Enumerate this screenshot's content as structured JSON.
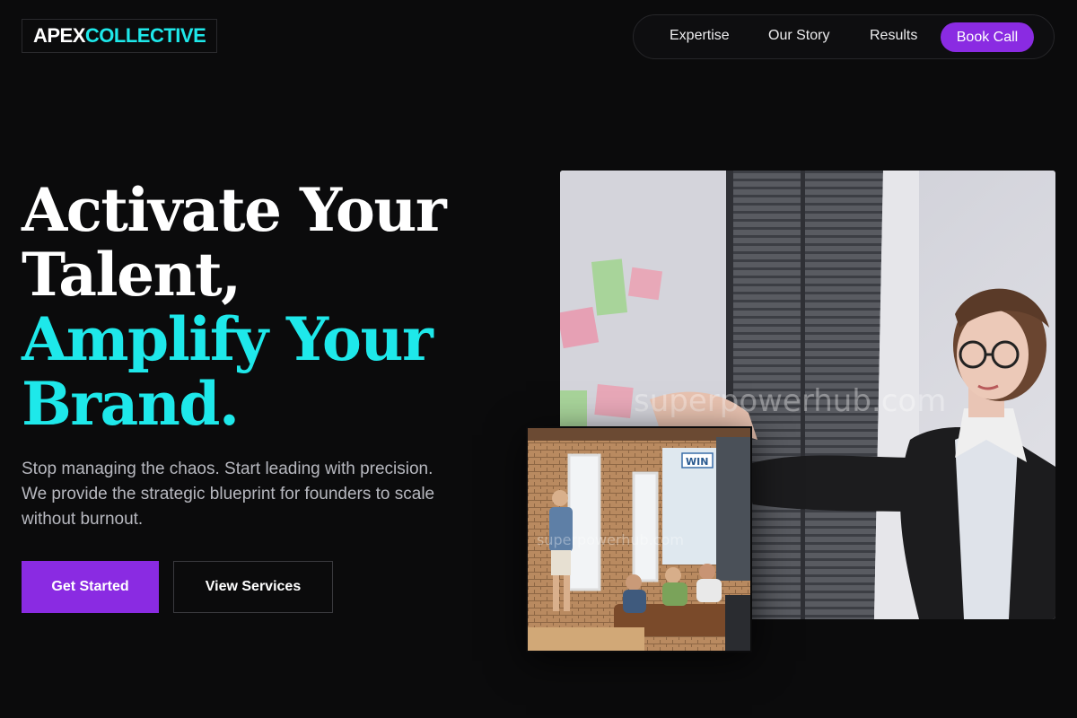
{
  "brand": {
    "part1": "APEX",
    "part2": "COLLECTIVE"
  },
  "nav": {
    "items": [
      {
        "label": "Expertise"
      },
      {
        "label": "Our Story"
      },
      {
        "label": "Results"
      }
    ],
    "cta": "Book Call"
  },
  "hero": {
    "headline": {
      "line1": "Activate Your",
      "line2": "Talent,",
      "line3": "Amplify Your",
      "line4": "Brand."
    },
    "subtext": "Stop managing the chaos. Start leading with precision. We provide the strategic blueprint for founders to scale without burnout.",
    "primary_button": "Get Started",
    "secondary_button": "View Services"
  },
  "images": {
    "main_watermark": "superpowerhub.com",
    "small_watermark": "superpowerhub.com",
    "small_sign": "WIN"
  },
  "colors": {
    "background": "#0b0b0c",
    "accent_cyan": "#1ee8ea",
    "accent_purple": "#8a2be2"
  }
}
